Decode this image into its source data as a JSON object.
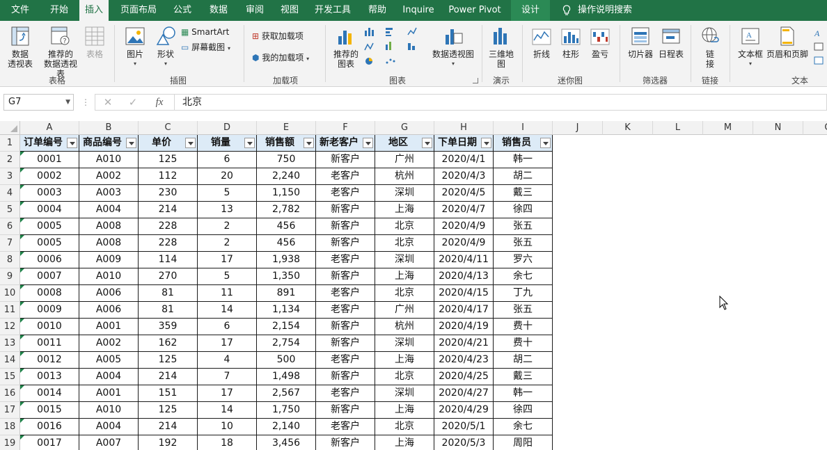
{
  "ribbon_tabs": [
    "文件",
    "开始",
    "插入",
    "页面布局",
    "公式",
    "数据",
    "审阅",
    "视图",
    "开发工具",
    "帮助",
    "Inquire",
    "Power Pivot",
    "设计"
  ],
  "tell_me": "操作说明搜索",
  "groups": {
    "tables": {
      "label": "表格",
      "pivot": "数据\n透视表",
      "recommended_pivot": "推荐的\n数据透视表",
      "table": "表格"
    },
    "illustrations": {
      "label": "插图",
      "pictures": "图片",
      "shapes": "形状",
      "smartart": "SmartArt",
      "screenshot": "屏幕截图"
    },
    "addins": {
      "label": "加载项",
      "get": "获取加载项",
      "mine": "我的加载项"
    },
    "charts": {
      "label": "图表",
      "recommended": "推荐的\n图表",
      "pivot_chart": "数据透视图"
    },
    "tours": {
      "label": "演示",
      "map3d": "三维地\n图"
    },
    "sparklines": {
      "label": "迷你图",
      "line": "折线",
      "column": "柱形",
      "winloss": "盈亏"
    },
    "filters": {
      "label": "筛选器",
      "slicer": "切片器",
      "timeline": "日程表"
    },
    "links": {
      "label": "链接",
      "link": "链\n接"
    },
    "text": {
      "label": "文本",
      "textbox": "文本框",
      "header_footer": "页眉和页脚"
    }
  },
  "formula_bar": {
    "name_box": "G7",
    "fx": "fx",
    "content": "北京"
  },
  "columns": [
    "A",
    "B",
    "C",
    "D",
    "E",
    "F",
    "G",
    "H",
    "I",
    "J",
    "K",
    "L",
    "M",
    "N",
    "O"
  ],
  "table_headers": [
    "订单编号",
    "商品编号",
    "单价",
    "销量",
    "销售额",
    "新老客户",
    "地区",
    "下单日期",
    "销售员"
  ],
  "rows": [
    [
      "0001",
      "A010",
      "125",
      "6",
      "750",
      "新客户",
      "广州",
      "2020/4/1",
      "韩一"
    ],
    [
      "0002",
      "A002",
      "112",
      "20",
      "2,240",
      "老客户",
      "杭州",
      "2020/4/3",
      "胡二"
    ],
    [
      "0003",
      "A003",
      "230",
      "5",
      "1,150",
      "老客户",
      "深圳",
      "2020/4/5",
      "戴三"
    ],
    [
      "0004",
      "A004",
      "214",
      "13",
      "2,782",
      "新客户",
      "上海",
      "2020/4/7",
      "徐四"
    ],
    [
      "0005",
      "A008",
      "228",
      "2",
      "456",
      "新客户",
      "北京",
      "2020/4/9",
      "张五"
    ],
    [
      "0005",
      "A008",
      "228",
      "2",
      "456",
      "新客户",
      "北京",
      "2020/4/9",
      "张五"
    ],
    [
      "0006",
      "A009",
      "114",
      "17",
      "1,938",
      "老客户",
      "深圳",
      "2020/4/11",
      "罗六"
    ],
    [
      "0007",
      "A010",
      "270",
      "5",
      "1,350",
      "新客户",
      "上海",
      "2020/4/13",
      "余七"
    ],
    [
      "0008",
      "A006",
      "81",
      "11",
      "891",
      "老客户",
      "北京",
      "2020/4/15",
      "丁九"
    ],
    [
      "0009",
      "A006",
      "81",
      "14",
      "1,134",
      "老客户",
      "广州",
      "2020/4/17",
      "张五"
    ],
    [
      "0010",
      "A001",
      "359",
      "6",
      "2,154",
      "新客户",
      "杭州",
      "2020/4/19",
      "费十"
    ],
    [
      "0011",
      "A002",
      "162",
      "17",
      "2,754",
      "新客户",
      "深圳",
      "2020/4/21",
      "费十"
    ],
    [
      "0012",
      "A005",
      "125",
      "4",
      "500",
      "老客户",
      "上海",
      "2020/4/23",
      "胡二"
    ],
    [
      "0013",
      "A004",
      "214",
      "7",
      "1,498",
      "新客户",
      "北京",
      "2020/4/25",
      "戴三"
    ],
    [
      "0014",
      "A001",
      "151",
      "17",
      "2,567",
      "老客户",
      "深圳",
      "2020/4/27",
      "韩一"
    ],
    [
      "0015",
      "A010",
      "125",
      "14",
      "1,750",
      "新客户",
      "上海",
      "2020/4/29",
      "徐四"
    ],
    [
      "0016",
      "A004",
      "214",
      "10",
      "2,140",
      "老客户",
      "北京",
      "2020/5/1",
      "余七"
    ],
    [
      "0017",
      "A007",
      "192",
      "18",
      "3,456",
      "新客户",
      "上海",
      "2020/5/3",
      "周阳"
    ]
  ],
  "colors": {
    "ribbon_green": "#217346",
    "header_fill": "#ddebf7",
    "error_triangle": "#1e8449"
  }
}
